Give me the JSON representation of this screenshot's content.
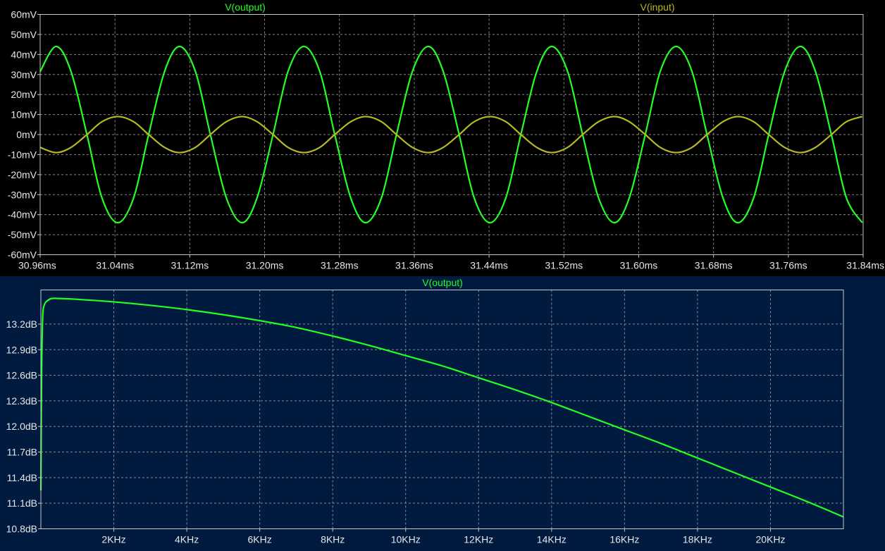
{
  "colors": {
    "pane1_bg": "#000000",
    "pane2_bg": "#001a40",
    "grid": "#8a8a8a",
    "border": "#c8c8c8",
    "label": "#e6e6e6",
    "output": "#22ff22",
    "input": "#b8b820"
  },
  "chart_data": [
    {
      "type": "line",
      "xlabel": "",
      "ylabel": "",
      "xlim": [
        30.96,
        31.84
      ],
      "ylim": [
        -60,
        60
      ],
      "grid": true,
      "legend": "top",
      "xticks": [
        30.96,
        31.04,
        31.12,
        31.2,
        31.28,
        31.36,
        31.44,
        31.52,
        31.6,
        31.68,
        31.76,
        31.84
      ],
      "x_tick_labels": [
        "30.96ms",
        "31.04ms",
        "31.12ms",
        "31.20ms",
        "31.28ms",
        "31.36ms",
        "31.44ms",
        "31.52ms",
        "31.60ms",
        "31.68ms",
        "31.76ms",
        "31.84ms"
      ],
      "yticks": [
        60,
        50,
        40,
        30,
        20,
        10,
        0,
        -10,
        -20,
        -30,
        -40,
        -50,
        -60
      ],
      "y_tick_labels": [
        "60mV",
        "50mV",
        "40mV",
        "30mV",
        "20mV",
        "10mV",
        "0mV",
        "-10mV",
        "-20mV",
        "-30mV",
        "-40mV",
        "-50mV",
        "-60mV"
      ],
      "series": [
        {
          "name": "V(output)",
          "color_key": "output",
          "x": [
            30.96,
            30.977,
            30.993,
            31.01,
            31.026,
            31.043,
            31.06,
            31.076,
            31.093,
            31.109,
            31.126,
            31.142,
            31.159,
            31.176,
            31.192,
            31.209,
            31.225,
            31.242,
            31.259,
            31.275,
            31.292,
            31.308,
            31.325,
            31.341,
            31.358,
            31.375,
            31.391,
            31.408,
            31.424,
            31.441,
            31.458,
            31.474,
            31.491,
            31.507,
            31.524,
            31.54,
            31.557,
            31.574,
            31.59,
            31.607,
            31.623,
            31.64,
            31.657,
            31.673,
            31.69,
            31.706,
            31.723,
            31.739,
            31.756,
            31.773,
            31.789,
            31.806,
            31.822,
            31.839
          ],
          "y": [
            31.5,
            44.0,
            31.5,
            0.0,
            -31.5,
            -44.0,
            -31.5,
            0.0,
            31.5,
            44.0,
            31.5,
            0.0,
            -31.5,
            -44.0,
            -31.5,
            0.0,
            31.5,
            44.0,
            31.5,
            0.0,
            -31.5,
            -44.0,
            -31.5,
            0.0,
            31.5,
            44.0,
            31.5,
            0.0,
            -31.5,
            -44.0,
            -31.5,
            0.0,
            31.5,
            44.0,
            31.5,
            0.0,
            -31.5,
            -44.0,
            -31.5,
            0.0,
            31.5,
            44.0,
            31.5,
            0.0,
            -31.5,
            -44.0,
            -31.5,
            0.0,
            31.5,
            44.0,
            31.5,
            0.0,
            -31.5,
            -44.0
          ]
        },
        {
          "name": "V(input)",
          "color_key": "input",
          "x": [
            30.96,
            30.977,
            30.993,
            31.01,
            31.026,
            31.043,
            31.06,
            31.076,
            31.093,
            31.109,
            31.126,
            31.142,
            31.159,
            31.176,
            31.192,
            31.209,
            31.225,
            31.242,
            31.259,
            31.275,
            31.292,
            31.308,
            31.325,
            31.341,
            31.358,
            31.375,
            31.391,
            31.408,
            31.424,
            31.441,
            31.458,
            31.474,
            31.491,
            31.507,
            31.524,
            31.54,
            31.557,
            31.574,
            31.59,
            31.607,
            31.623,
            31.64,
            31.657,
            31.673,
            31.69,
            31.706,
            31.723,
            31.739,
            31.756,
            31.773,
            31.789,
            31.806,
            31.822,
            31.839
          ],
          "y": [
            -6.4,
            -9.0,
            -6.4,
            0.0,
            6.4,
            9.0,
            6.4,
            0.0,
            -6.4,
            -9.0,
            -6.4,
            0.0,
            6.4,
            9.0,
            6.4,
            0.0,
            -6.4,
            -9.0,
            -6.4,
            0.0,
            6.4,
            9.0,
            6.4,
            0.0,
            -6.4,
            -9.0,
            -6.4,
            0.0,
            6.4,
            9.0,
            6.4,
            0.0,
            -6.4,
            -9.0,
            -6.4,
            0.0,
            6.4,
            9.0,
            6.4,
            0.0,
            -6.4,
            -9.0,
            -6.4,
            0.0,
            6.4,
            9.0,
            6.4,
            0.0,
            -6.4,
            -9.0,
            -6.4,
            0.0,
            6.4,
            9.0
          ]
        }
      ]
    },
    {
      "type": "line",
      "xlabel": "",
      "ylabel": "",
      "xlim": [
        0,
        22
      ],
      "ylim": [
        10.8,
        13.6
      ],
      "grid": true,
      "legend": "top",
      "xticks": [
        2,
        4,
        6,
        8,
        10,
        12,
        14,
        16,
        18,
        20
      ],
      "x_tick_labels": [
        "2KHz",
        "4KHz",
        "6KHz",
        "8KHz",
        "10KHz",
        "12KHz",
        "14KHz",
        "16KHz",
        "18KHz",
        "20KHz"
      ],
      "yticks": [
        13.2,
        12.9,
        12.6,
        12.3,
        12.0,
        11.7,
        11.4,
        11.1,
        10.8
      ],
      "y_tick_labels": [
        "13.2dB",
        "12.9dB",
        "12.6dB",
        "12.3dB",
        "12.0dB",
        "11.7dB",
        "11.4dB",
        "11.1dB",
        "10.8dB"
      ],
      "series": [
        {
          "name": "V(output)",
          "color_key": "output",
          "x": [
            0.0,
            0.02,
            0.05,
            0.1,
            0.2,
            0.3,
            0.5,
            1,
            2,
            3,
            4,
            5,
            6,
            7,
            8,
            9,
            10,
            11,
            12,
            13,
            14,
            15,
            16,
            17,
            18,
            19,
            20,
            21,
            22
          ],
          "y": [
            11.25,
            12.6,
            13.28,
            13.43,
            13.48,
            13.5,
            13.5,
            13.49,
            13.46,
            13.42,
            13.37,
            13.31,
            13.24,
            13.16,
            13.06,
            12.95,
            12.83,
            12.71,
            12.57,
            12.43,
            12.28,
            12.12,
            11.96,
            11.8,
            11.63,
            11.46,
            11.29,
            11.12,
            10.94
          ]
        }
      ]
    }
  ]
}
